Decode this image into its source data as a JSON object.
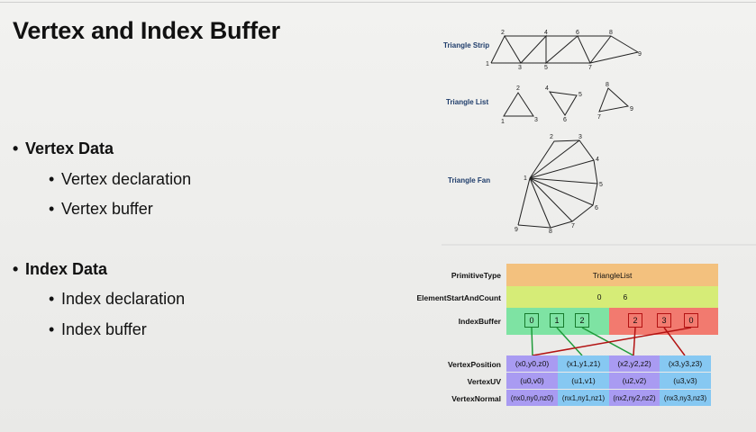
{
  "slide": {
    "title": "Vertex and Index Buffer",
    "bullets": [
      {
        "label": "Vertex Data",
        "children": [
          "Vertex declaration",
          "Vertex buffer"
        ]
      },
      {
        "label": "Index Data",
        "children": [
          "Index declaration",
          "Index buffer"
        ]
      }
    ]
  },
  "diagram": {
    "strip": {
      "label": "Triangle Strip",
      "vertex_labels": [
        "1",
        "2",
        "3",
        "4",
        "5",
        "6",
        "7",
        "8",
        "9"
      ]
    },
    "list": {
      "label": "Triangle List",
      "vertex_labels": [
        "1",
        "2",
        "3",
        "4",
        "5",
        "6",
        "7",
        "8",
        "9"
      ]
    },
    "fan": {
      "label": "Triangle Fan",
      "vertex_labels": [
        "1",
        "2",
        "3",
        "4",
        "5",
        "6",
        "7",
        "8",
        "9"
      ]
    }
  },
  "buffer_table": {
    "primitive_type_label": "PrimitiveType",
    "primitive_type_value": "TriangleList",
    "element_label": "ElementStartAndCount",
    "element_start": "0",
    "element_count": "6",
    "index_buffer_label": "IndexBuffer",
    "indices": [
      "0",
      "1",
      "2",
      "2",
      "3",
      "0"
    ],
    "vertex_position_label": "VertexPosition",
    "vertex_positions": [
      "(x0,y0,z0)",
      "(x1,y1,z1)",
      "(x2,y2,z2)",
      "(x3,y3,z3)"
    ],
    "vertex_uv_label": "VertexUV",
    "vertex_uvs": [
      "(u0,v0)",
      "(u1,v1)",
      "(u2,v2)",
      "(u3,v3)"
    ],
    "vertex_normal_label": "VertexNormal",
    "vertex_normals": [
      "(nx0,ny0,nz0)",
      "(nx1,ny1,nz1)",
      "(nx2,ny2,nz2)",
      "(nx3,ny3,nz3)"
    ]
  },
  "colors": {
    "primitive_row": "#f3c17e",
    "element_row": "#d6ec77",
    "index_green": "#7ee3a3",
    "index_red": "#f27a6f",
    "vertex_purple": "#a99bf2",
    "vertex_blue": "#86c8f2"
  }
}
